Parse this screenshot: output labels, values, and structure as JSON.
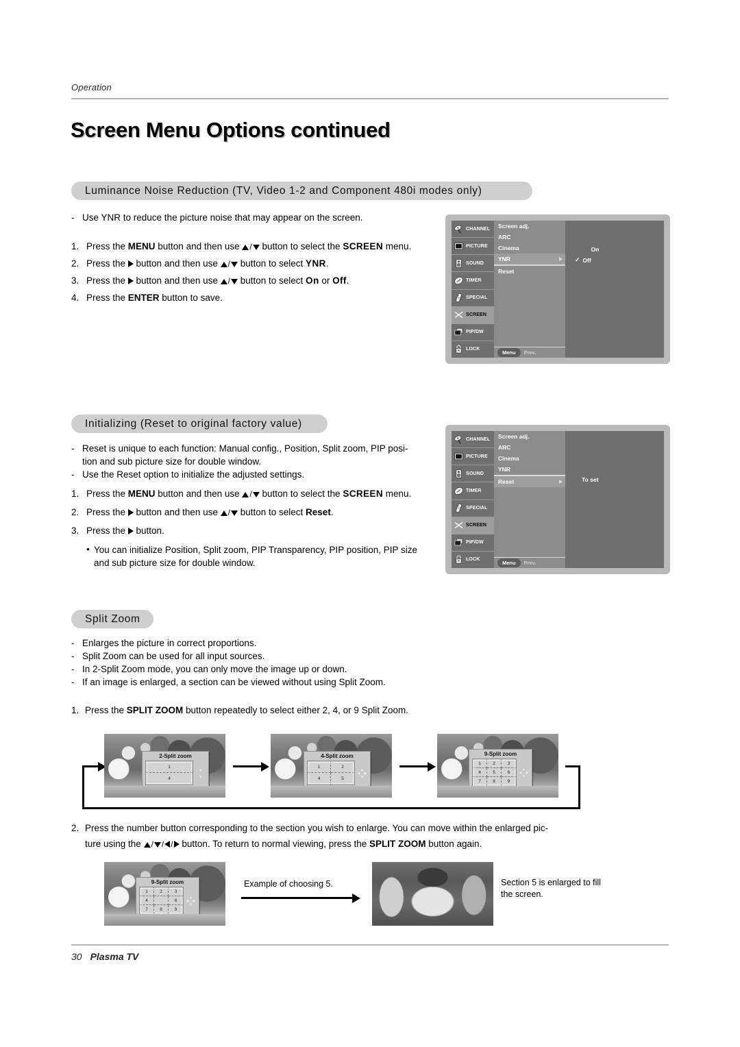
{
  "header": {
    "running_head": "Operation",
    "title": "Screen Menu Options continued"
  },
  "sections": [
    {
      "id": "ynr",
      "heading": "Luminance Noise Reduction (TV, Video 1-2 and Component 480i modes only)",
      "bullets": [
        "Use YNR to reduce the picture noise that may appear on the screen."
      ],
      "steps": [
        {
          "n": "1.",
          "parts": [
            "Press the ",
            "MENU",
            " button and then use ",
            "▲",
            "/",
            "▼",
            " button to select the ",
            "SCREEN",
            " menu."
          ]
        },
        {
          "n": "2.",
          "parts": [
            "Press the ",
            "▶",
            " button and then use ",
            "▲",
            "/",
            "▼",
            " button to select ",
            "YNR",
            "."
          ]
        },
        {
          "n": "3.",
          "parts": [
            "Press the ",
            "▶",
            " button and then use ",
            "▲",
            "/",
            "▼",
            " button to select ",
            "On",
            " or ",
            "Off",
            "."
          ]
        },
        {
          "n": "4.",
          "parts": [
            "Press the ",
            "ENTER",
            " button to save."
          ]
        }
      ],
      "step1": {
        "pre": "Press the ",
        "b1": "MENU",
        "mid": " button and then use ",
        "mid2": " button to select the ",
        "b2": "SCREEN",
        "post": " menu."
      },
      "step2": {
        "pre": "Press the ",
        "mid": " button and then use ",
        "mid2": " button to select ",
        "b2": "YNR",
        "post": "."
      },
      "step3": {
        "pre": "Press the ",
        "mid": " button and then use ",
        "mid2": " button to select ",
        "b2": "On",
        "between": " or ",
        "b3": "Off",
        "post": "."
      },
      "step4": {
        "pre": "Press the ",
        "b1": "ENTER",
        "post": " button to save."
      }
    },
    {
      "id": "init",
      "heading": "Initializing (Reset to original factory value)",
      "bullet1_line1": "Reset is unique to each function: Manual config., Position, Split zoom, PIP posi-",
      "bullet1_line2": "tion and sub picture size for double window.",
      "bullet2": "Use the Reset option to initialize the adjusted settings.",
      "step1": {
        "pre": "Press the ",
        "b1": "MENU",
        "mid": " button and then use ",
        "mid2": " button to select the ",
        "b2": "SCREEN",
        "post": " menu."
      },
      "step2": {
        "pre": "Press the ",
        "mid": " button and then use ",
        "mid2": " button to select ",
        "b2": "Reset",
        "post": "."
      },
      "step3": {
        "pre": "Press the ",
        "post": " button."
      },
      "note_line1": "You can initialize Position, Split zoom, PIP Transparency, PIP position, PIP size",
      "note_line2": "and sub picture size for double window."
    },
    {
      "id": "splitzoom",
      "heading": "Split Zoom",
      "bullets": [
        "Enlarges the picture in correct proportions.",
        "Split Zoom can be used for all input sources.",
        "In 2-Split Zoom mode, you can only move the image up or down.",
        "If an image is enlarged, a section can be viewed without using Split Zoom."
      ],
      "step1": {
        "pre": "Press the ",
        "b1": "SPLIT ZOOM",
        "post": " button repeatedly to select either 2, 4, or 9 Split Zoom."
      },
      "step2_line1": "Press the number button corresponding to the section you wish to enlarge. You can move within the enlarged pic-",
      "step2_line2a": "ture using the ",
      "step2_line2b": " button. To return to normal viewing, press the ",
      "step2_b": "SPLIT ZOOM",
      "step2_line2c": " button again.",
      "caption_example": "Example of choosing 5.",
      "caption_result_line1": "Section 5 is enlarged to fill",
      "caption_result_line2": "the screen."
    }
  ],
  "osd": {
    "sidebar": [
      {
        "label": "CHANNEL",
        "icon": "satellite-dish-icon",
        "selected": false
      },
      {
        "label": "PICTURE",
        "icon": "tv-screen-icon",
        "selected": false
      },
      {
        "label": "SOUND",
        "icon": "speaker-icon",
        "selected": false
      },
      {
        "label": "TIMER",
        "icon": "clock-icon",
        "selected": false
      },
      {
        "label": "SPECIAL",
        "icon": "remote-control-icon",
        "selected": false
      },
      {
        "label": "SCREEN",
        "icon": "screen-adjust-icon",
        "selected": true
      },
      {
        "label": "PIP/DW",
        "icon": "pip-windows-icon",
        "selected": false
      },
      {
        "label": "LOCK",
        "icon": "padlock-icon",
        "selected": false
      }
    ],
    "menu_items": [
      "Screen adj.",
      "ARC",
      "Cinema",
      "YNR",
      "Reset"
    ],
    "footer": {
      "menu_label": "Menu",
      "prev_label": "Prev."
    },
    "panel_ynr": {
      "highlighted_item": "YNR",
      "options": [
        "On",
        "Off"
      ],
      "checked": "Off"
    },
    "panel_reset": {
      "highlighted_item": "Reset",
      "value_label": "To set"
    }
  },
  "split_zoom_figures": [
    {
      "title": "2-Split zoom",
      "cols": 1,
      "rows": 2,
      "cells": [
        "1",
        "4"
      ],
      "pad": "up-down"
    },
    {
      "title": "4-Split zoom",
      "cols": 2,
      "rows": 2,
      "cells": [
        "1",
        "2",
        "4",
        "5"
      ],
      "pad": "all"
    },
    {
      "title": "9-Split zoom",
      "cols": 3,
      "rows": 3,
      "cells": [
        "1",
        "2",
        "3",
        "4",
        "5",
        "6",
        "7",
        "8",
        "9"
      ],
      "pad": "all"
    }
  ],
  "bottom_figure": {
    "title": "9-Split zoom",
    "cells": [
      "1",
      "2",
      "3",
      "4",
      "",
      "6",
      "7",
      "8",
      "9"
    ]
  },
  "footer": {
    "page_number": "30",
    "product": "Plasma TV"
  },
  "colors": {
    "heading_pill": "#cfcfcf",
    "osd_frame": "#b9b9b9",
    "osd_panel": "#6f6f6f",
    "osd_list": "#8c8c8c",
    "osd_highlight": "#9d9d9d",
    "rule": "#b4b4b4"
  }
}
